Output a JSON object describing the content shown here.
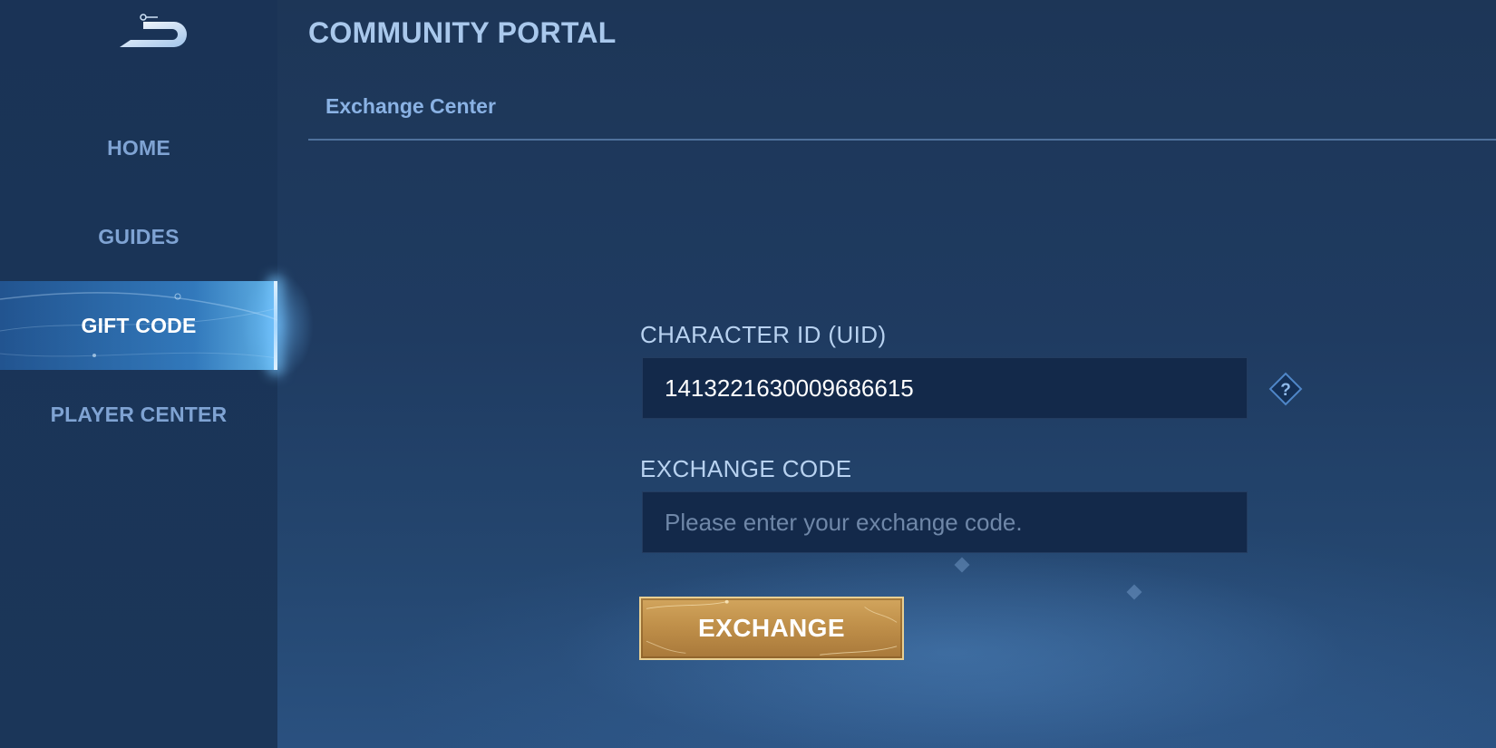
{
  "header": {
    "title": "COMMUNITY PORTAL",
    "breadcrumb": "Exchange Center"
  },
  "sidebar": {
    "logo_icon": "back-arrow-icon",
    "items": [
      {
        "label": "HOME",
        "active": false
      },
      {
        "label": "GUIDES",
        "active": false
      },
      {
        "label": "GIFT CODE",
        "active": true
      },
      {
        "label": "PLAYER CENTER",
        "active": false
      }
    ]
  },
  "form": {
    "uid_label": "CHARACTER ID (UID)",
    "uid_value": "141322163000968661 5",
    "uid_help_icon": "question-diamond-icon",
    "code_label": "EXCHANGE CODE",
    "code_value": "",
    "code_placeholder": "Please enter your exchange code.",
    "submit_label": "EXCHANGE"
  },
  "colors": {
    "background": "#1d3657",
    "sidebar": "#1a3356",
    "active_nav": "#3c96e6",
    "button_gold": "#c0904a",
    "input_bg": "#13294a"
  }
}
